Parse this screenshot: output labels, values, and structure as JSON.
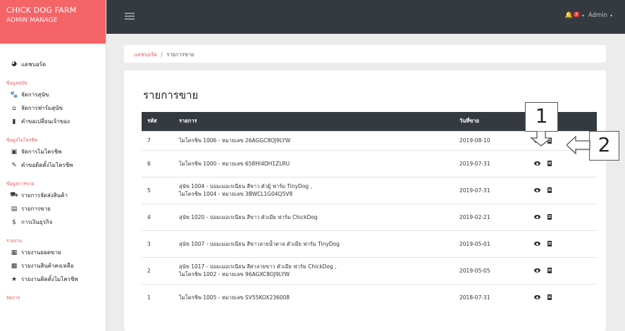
{
  "brand": {
    "title": "CHICK DOG FARM",
    "subtitle": "ADMIN MANAGE"
  },
  "sidebar": {
    "dashboard": "แดชบอร์ด",
    "sections": [
      {
        "header": "ข้อมูลสุนัข",
        "items": [
          {
            "icon": "paw-icon",
            "glyph": "🐾",
            "label": "จัดการสุนัข"
          },
          {
            "icon": "warehouse-icon",
            "glyph": "⌂",
            "label": "จัดการฟาร์มสุนัข"
          },
          {
            "icon": "bookmark-icon",
            "glyph": "▮",
            "label": "คำขอเปลี่ยนเจ้าของ"
          }
        ]
      },
      {
        "header": "ข้อมูลไมโครชิพ",
        "items": [
          {
            "icon": "microchip-icon",
            "glyph": "▣",
            "label": "จัดการไมโครชิพ"
          },
          {
            "icon": "syringe-icon",
            "glyph": "✎",
            "label": "คำขอติดตั้งไมโครชิพ"
          }
        ]
      },
      {
        "header": "ข้อมูลการขาย",
        "items": [
          {
            "icon": "truck-icon",
            "glyph": "⛟",
            "label": "รายการจัดส่งสินค้า"
          },
          {
            "icon": "cash-register-icon",
            "glyph": "▤",
            "label": "รายการขาย"
          },
          {
            "icon": "dollar-icon",
            "glyph": "$",
            "label": "การเงินธุรกิจ"
          }
        ]
      },
      {
        "header": "รายงาน",
        "items": [
          {
            "icon": "file-icon",
            "glyph": "▦",
            "label": "รายงานยอดขาย"
          },
          {
            "icon": "box-icon",
            "glyph": "▩",
            "label": "รายงานสินค้าคงเหลือ"
          },
          {
            "icon": "star-icon",
            "glyph": "★",
            "label": "รายงานติดตั้งไมโครชิพ"
          }
        ]
      },
      {
        "header": "จัดการ",
        "items": []
      }
    ]
  },
  "topbar": {
    "badge": "3",
    "user": "Admin"
  },
  "breadcrumb": {
    "home": "แดชบอร์ด",
    "separator": "/",
    "current": "รายการขาย"
  },
  "page": {
    "title": "รายการขาย"
  },
  "table": {
    "headers": {
      "id": "รหัส",
      "item": "รายการ",
      "date": "วันที่ขาย",
      "actions": "ราการ"
    },
    "rows": [
      {
        "id": "7",
        "lines": [
          "ไมโครชิพ 1006 - หมายเลข 26AGGC8OJ9LYW"
        ],
        "date": "2019-08-10"
      },
      {
        "id": "6",
        "lines": [
          "ไมโครชิพ 1000 - หมายเลข 658HI4DH1ZLRU"
        ],
        "date": "2019-07-31"
      },
      {
        "id": "5",
        "lines": [
          "สุนัข 1004 - ปอมเมอเรเนียน สีขาว ตัวผู้ ฟาร์ม TinyDog ,",
          "ไมโครชิพ 1004 - หมายเลข 3BWCL1G04Q5V8"
        ],
        "date": "2019-07-31"
      },
      {
        "id": "4",
        "lines": [
          "สุนัข 1020 - ปอมเมอเรเนียน สีขาว ตัวเมีย ฟาร์ม ChickDog"
        ],
        "date": "2019-02-21"
      },
      {
        "id": "3",
        "lines": [
          "สุนัข 1007 - ปอมเมอเรเนียน สีขาวลายน้ำตาล ตัวเมีย ฟาร์ม TinyDog"
        ],
        "date": "2019-05-01"
      },
      {
        "id": "2",
        "lines": [
          "สุนัข 1017 - ปอมเมอเรเนียน สีศาลายขาว ตัวเมีย ฟาร์ม ChickDog ,",
          "ไมโครชิพ 1002 - หมายเลข 96AGXC8OJ9LYW"
        ],
        "date": "2019-05-05"
      },
      {
        "id": "1",
        "lines": [
          "ไมโครชิพ 1005 - หมายเลข SV55KOX236008"
        ],
        "date": "2018-07-31"
      }
    ]
  },
  "annotations": {
    "one": "1",
    "two": "2"
  },
  "colors": {
    "brand": "#f56467",
    "topbar": "#343a40",
    "accent": "#e55b5e"
  }
}
